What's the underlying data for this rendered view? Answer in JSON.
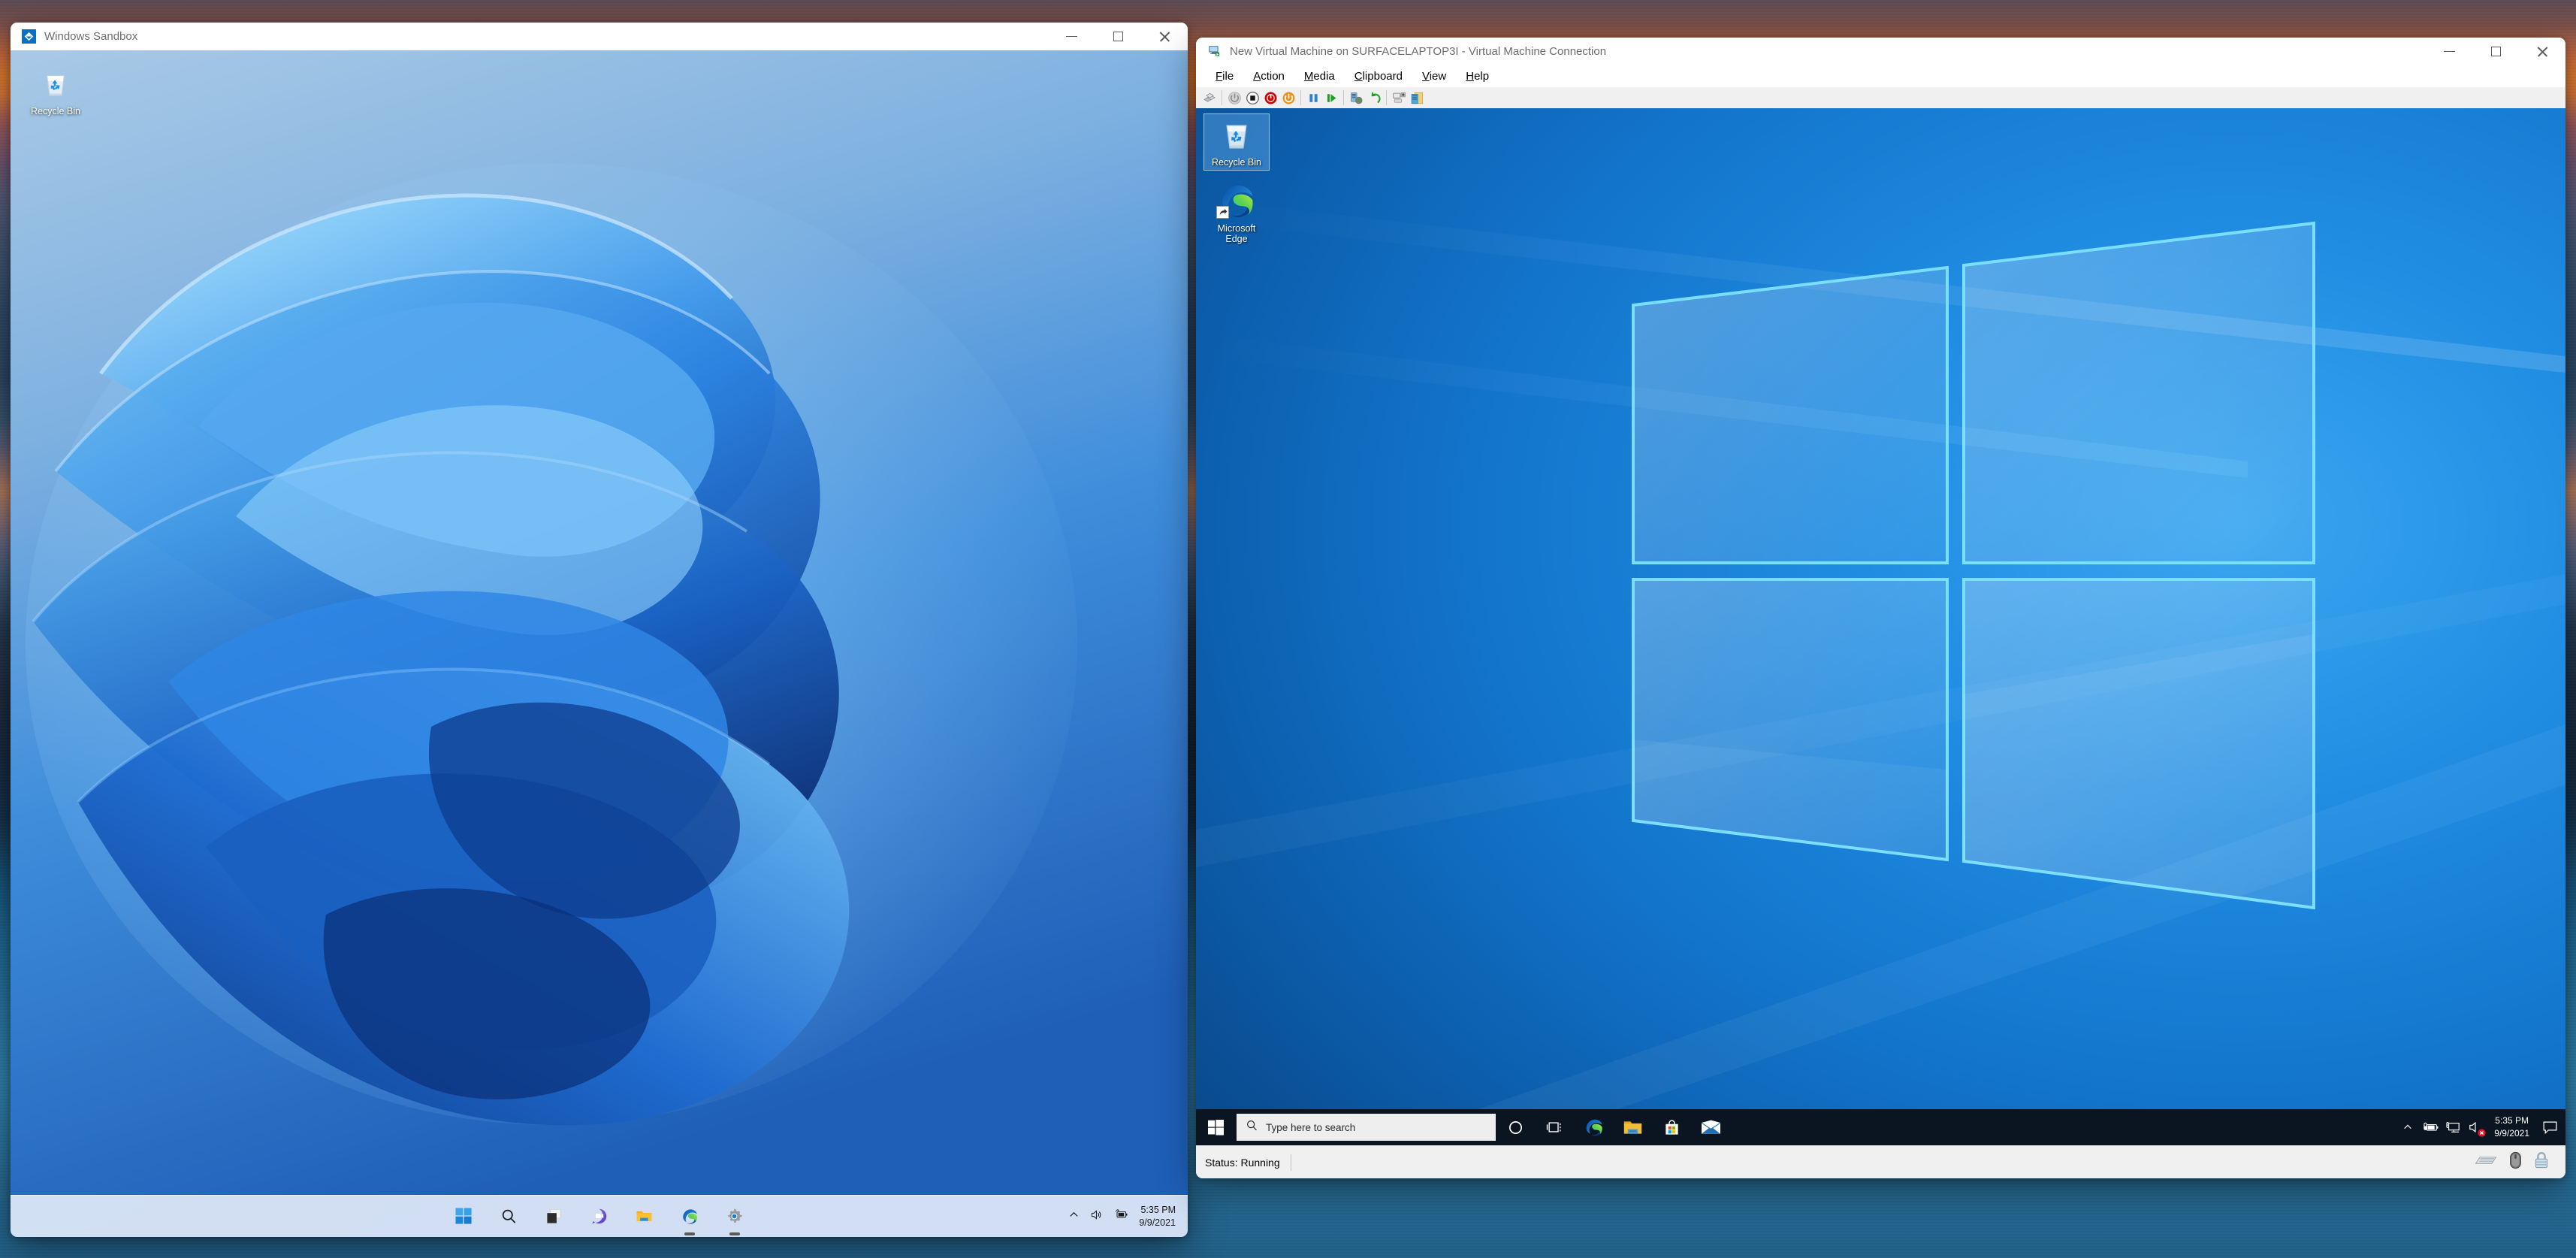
{
  "host": {
    "wallpaper_name": "sunset-ocean-wallpaper"
  },
  "sandbox_window": {
    "title": "Windows Sandbox",
    "icon": "windows-sandbox-icon",
    "controls": {
      "minimize": "—",
      "maximize": "☐",
      "close": "✕"
    },
    "desktop": {
      "icons": [
        {
          "name": "recycle-bin",
          "label": "Recycle Bin"
        }
      ],
      "wallpaper_name": "windows-11-bloom-wallpaper"
    },
    "taskbar": {
      "apps": [
        {
          "name": "start",
          "label": "Start",
          "running": false
        },
        {
          "name": "search",
          "label": "Search",
          "running": false
        },
        {
          "name": "task-view",
          "label": "Task View",
          "running": false
        },
        {
          "name": "chat",
          "label": "Chat",
          "running": false
        },
        {
          "name": "file-explorer",
          "label": "File Explorer",
          "running": false
        },
        {
          "name": "microsoft-edge",
          "label": "Microsoft Edge",
          "running": true
        },
        {
          "name": "settings",
          "label": "Settings",
          "running": true
        }
      ],
      "tray": [
        {
          "name": "show-hidden-icons",
          "label": "Show hidden icons"
        },
        {
          "name": "volume",
          "label": "Volume"
        },
        {
          "name": "battery-charging",
          "label": "Battery charging"
        }
      ],
      "clock": {
        "time": "5:35 PM",
        "date": "9/9/2021"
      }
    }
  },
  "vm_window": {
    "title": "New Virtual Machine on SURFACELAPTOP3I - Virtual Machine Connection",
    "icon": "virtual-machine-connection-icon",
    "controls": {
      "minimize": "—",
      "maximize": "☐",
      "close": "✕"
    },
    "menu": [
      {
        "name": "file",
        "label": "File",
        "accel": "F",
        "rest": "ile"
      },
      {
        "name": "action",
        "label": "Action",
        "accel": "A",
        "rest": "ction"
      },
      {
        "name": "media",
        "label": "Media",
        "accel": "M",
        "rest": "edia"
      },
      {
        "name": "clipboard",
        "label": "Clipboard",
        "accel": "C",
        "rest": "lipboard"
      },
      {
        "name": "view",
        "label": "View",
        "accel": "V",
        "rest": "iew"
      },
      {
        "name": "help",
        "label": "Help",
        "accel": "H",
        "rest": "elp"
      }
    ],
    "toolbar": [
      {
        "name": "ctrl-alt-delete-icon",
        "label": "Ctrl+Alt+Delete"
      },
      {
        "sep": true
      },
      {
        "name": "start-icon",
        "label": "Start"
      },
      {
        "name": "turn-off-icon",
        "label": "Turn Off"
      },
      {
        "name": "shut-down-icon",
        "label": "Shut Down"
      },
      {
        "name": "reset-icon",
        "label": "Reset"
      },
      {
        "sep": true
      },
      {
        "name": "pause-icon",
        "label": "Pause"
      },
      {
        "name": "resume-icon",
        "label": "Resume"
      },
      {
        "sep": true
      },
      {
        "name": "checkpoint-icon",
        "label": "Checkpoint"
      },
      {
        "name": "revert-icon",
        "label": "Revert"
      },
      {
        "sep": true
      },
      {
        "name": "enhanced-session-icon",
        "label": "Enhanced Session"
      },
      {
        "name": "shared-drive-icon",
        "label": "Shared Drive"
      }
    ],
    "guest": {
      "wallpaper_name": "windows-10-hero-wallpaper",
      "desktop_icons": [
        {
          "name": "recycle-bin",
          "label": "Recycle Bin",
          "selected": true,
          "shortcut": false
        },
        {
          "name": "microsoft-edge",
          "label": "Microsoft\nEdge",
          "label_line1": "Microsoft",
          "label_line2": "Edge",
          "selected": false,
          "shortcut": true
        }
      ],
      "taskbar": {
        "search_placeholder": "Type here to search",
        "apps": [
          {
            "name": "cortana",
            "label": "Cortana"
          },
          {
            "name": "task-view",
            "label": "Task View"
          },
          {
            "name": "microsoft-edge",
            "label": "Microsoft Edge"
          },
          {
            "name": "file-explorer",
            "label": "File Explorer"
          },
          {
            "name": "microsoft-store",
            "label": "Microsoft Store"
          },
          {
            "name": "mail",
            "label": "Mail"
          }
        ],
        "tray": [
          {
            "name": "show-hidden-icons",
            "label": "Show hidden icons"
          },
          {
            "name": "battery-charging",
            "label": "Battery charging"
          },
          {
            "name": "network",
            "label": "Network"
          },
          {
            "name": "volume-muted",
            "label": "Volume muted"
          }
        ],
        "clock": {
          "time": "5:35 PM",
          "date": "9/9/2021"
        },
        "notification_center": "Notification Center"
      }
    },
    "statusbar": {
      "status": "Status: Running",
      "indicators": [
        {
          "name": "keyboard-icon",
          "label": "Keyboard"
        },
        {
          "name": "mouse-icon",
          "label": "Mouse"
        },
        {
          "name": "lock-icon",
          "label": "Locked"
        }
      ]
    }
  },
  "colors": {
    "win11_accent": "#0078d4",
    "win10_taskbar": "#0a1521",
    "vm_screen_blue": "#1576cd",
    "edge_blue": "#0f6cbd",
    "mute_red": "#e81123"
  }
}
